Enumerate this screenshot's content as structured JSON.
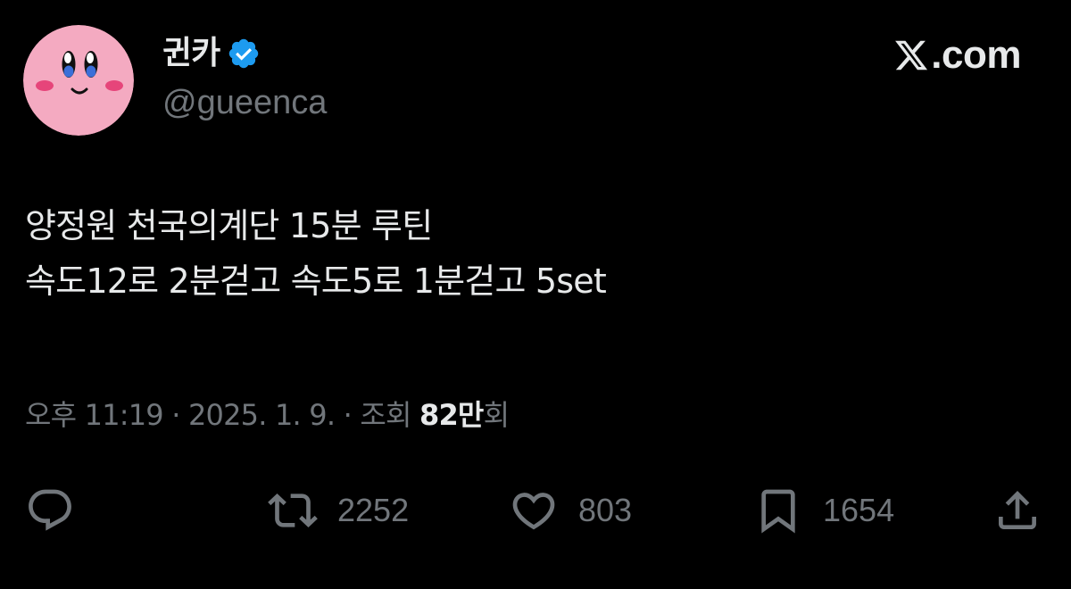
{
  "author": {
    "display_name": "귄카",
    "handle": "@gueenca",
    "verified": true,
    "avatar": "kirby-face-avatar"
  },
  "site": {
    "logo_text": ".com",
    "logo_icon": "x-logo-icon"
  },
  "tweet": {
    "lines": [
      "양정원 천국의계단 15분 루틴",
      "속도12로 2분걷고 속도5로 1분걷고 5set"
    ]
  },
  "meta": {
    "time": "오후 11:19",
    "separator": " · ",
    "date": "2025. 1. 9.",
    "views_label": "조회",
    "views_count": "82만",
    "views_suffix": "회"
  },
  "actions": {
    "reply": {
      "icon": "reply-icon",
      "count": ""
    },
    "retweet": {
      "icon": "retweet-icon",
      "count": "2252"
    },
    "like": {
      "icon": "heart-icon",
      "count": "803"
    },
    "bookmark": {
      "icon": "bookmark-icon",
      "count": "1654"
    },
    "share": {
      "icon": "share-icon",
      "count": ""
    }
  },
  "colors": {
    "background": "#000000",
    "text_primary": "#e7e9ea",
    "text_secondary": "#71767b",
    "verified_blue": "#1d9bf0",
    "avatar_pink": "#f4a9c0"
  }
}
